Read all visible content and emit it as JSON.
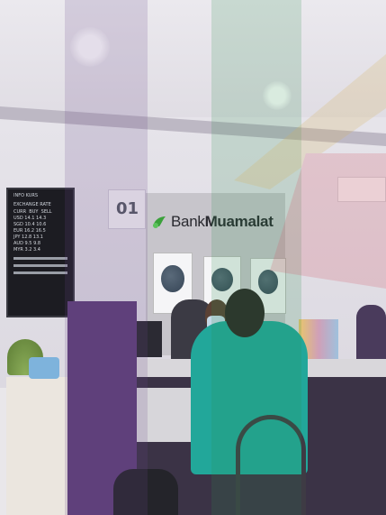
{
  "photo": {
    "subject": "bank-branch-interior",
    "counter_number": "01",
    "brand": {
      "light": "Bank",
      "bold": "Muamalat",
      "logo_color": "#3aa13a"
    },
    "info_board": {
      "title_lines": [
        "INFO KURS",
        "EXCHANGE RATE"
      ],
      "header": [
        "CURR",
        "BUY",
        "SELL"
      ],
      "rows": [
        [
          "USD",
          "14.1",
          "14.3"
        ],
        [
          "SGD",
          "10.4",
          "10.6"
        ],
        [
          "EUR",
          "16.2",
          "16.5"
        ],
        [
          "JPY",
          "12.8",
          "13.1"
        ],
        [
          "AUD",
          "9.5",
          "9.8"
        ],
        [
          "MYR",
          "3.2",
          "3.4"
        ]
      ]
    },
    "colors": {
      "purple": "#5d3f78",
      "teal_shirt": "#22a79a",
      "watermark_green": "#2e8f4e",
      "watermark_red": "#d45a6a"
    }
  }
}
